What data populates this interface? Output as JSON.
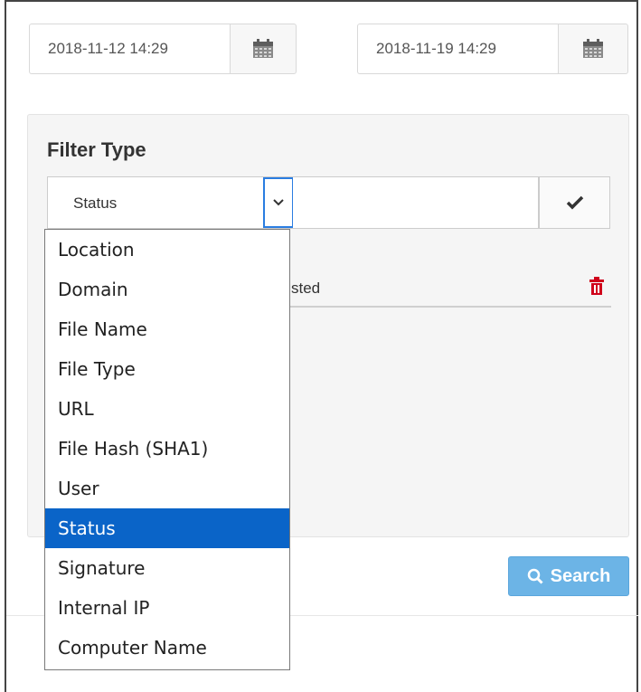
{
  "date_range": {
    "start": "2018-11-12 14:29",
    "end": "2018-11-19 14:29"
  },
  "filter": {
    "title": "Filter Type",
    "selected_type": "Status",
    "value": "",
    "existing_row_text": "sted",
    "options": [
      "Location",
      "Domain",
      "File Name",
      "File Type",
      "URL",
      "File Hash (SHA1)",
      "User",
      "Status",
      "Signature",
      "Internal IP",
      "Computer Name"
    ],
    "highlighted_option": "Status"
  },
  "search_button": {
    "label": "Search"
  },
  "icons": {
    "calendar": "calendar-icon",
    "dropdown_arrow": "chevron-down-icon",
    "apply": "checkmark-icon",
    "delete": "trash-icon",
    "search": "search-icon"
  },
  "colors": {
    "highlight": "#0a64c8",
    "search_button": "#6cb4e6",
    "delete_icon": "#d0021b",
    "focus_border": "#2a7de1"
  }
}
